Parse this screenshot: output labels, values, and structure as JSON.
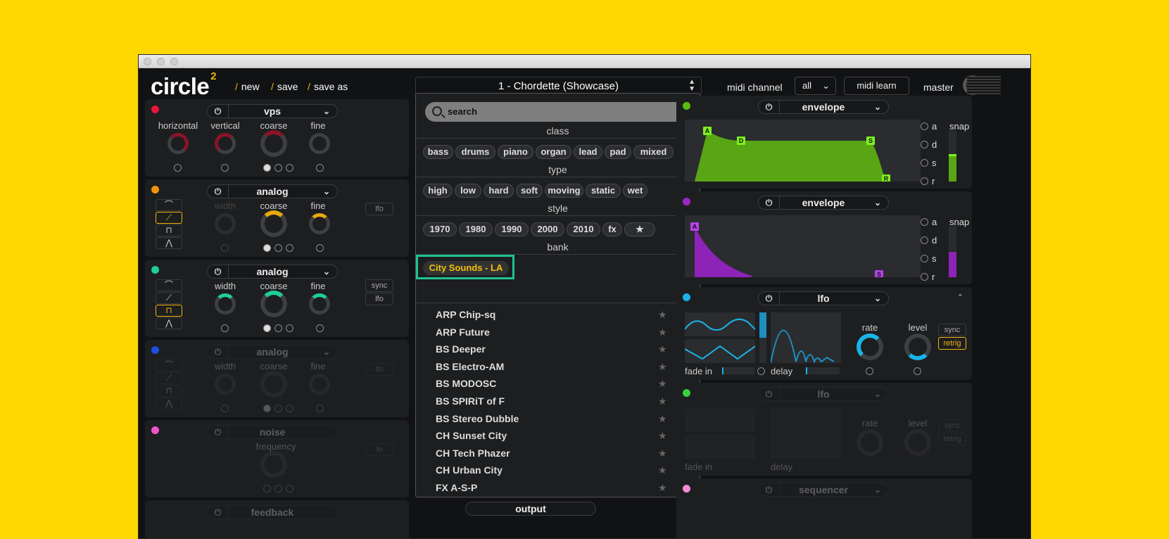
{
  "app": {
    "logo": "circle",
    "logo_sup": "2",
    "new": "new",
    "save": "save",
    "save_as": "save as",
    "preset": "1 - Chordette (Showcase)",
    "midi_channel_label": "midi channel",
    "midi_channel_value": "all",
    "midi_learn": "midi learn",
    "master": "master"
  },
  "modules": {
    "m1": {
      "name": "vps",
      "labels": [
        "horizontal",
        "vertical",
        "coarse",
        "fine"
      ],
      "color": "#e8153d"
    },
    "m2": {
      "name": "analog",
      "labels": [
        "width",
        "coarse",
        "fine"
      ],
      "btn": "lfo",
      "color": "#f2920c"
    },
    "m3": {
      "name": "analog",
      "labels": [
        "width",
        "coarse",
        "fine"
      ],
      "btn1": "sync",
      "btn2": "lfo",
      "color": "#1fcf95"
    },
    "m4": {
      "name": "analog",
      "labels": [
        "width",
        "coarse",
        "fine"
      ],
      "btn": "lfo",
      "color": "#1a4fe0"
    },
    "m5": {
      "name": "noise",
      "labels": [
        "frequency"
      ],
      "btn": "lo",
      "color": "#f055c8"
    },
    "m6": {
      "name": "feedback"
    }
  },
  "browser": {
    "search_placeholder": "search",
    "class_title": "class",
    "class": [
      "bass",
      "drums",
      "piano",
      "organ",
      "lead",
      "pad",
      "mixed"
    ],
    "type_title": "type",
    "type": [
      "high",
      "low",
      "hard",
      "soft",
      "moving",
      "static",
      "wet"
    ],
    "style_title": "style",
    "style": [
      "1970",
      "1980",
      "1990",
      "2000",
      "2010",
      "fx",
      "★"
    ],
    "bank_title": "bank",
    "bank_selected": "City Sounds - LA",
    "presets": [
      "ARP Chip-sq",
      "ARP Future",
      "BS Deeper",
      "BS Electro-AM",
      "BS MODOSC",
      "BS SPIRiT of F",
      "BS Stereo Dubble",
      "CH Sunset City",
      "CH Tech Phazer",
      "CH Urban City",
      "FX A-S-P"
    ],
    "star": "★",
    "output": "output"
  },
  "right": {
    "env1": {
      "name": "envelope",
      "color": "#58bd13",
      "nodes": [
        "A",
        "D",
        "S",
        "R"
      ]
    },
    "env2": {
      "name": "envelope",
      "color": "#9d25c7",
      "nodes": [
        "A",
        "S"
      ]
    },
    "options": [
      "a",
      "d",
      "s",
      "r"
    ],
    "snap": "snap",
    "lfo1": {
      "name": "lfo",
      "color": "#19b4e8",
      "rate": "rate",
      "level": "level",
      "sync": "sync",
      "retrig": "retrig",
      "fade_in": "fade in",
      "delay": "delay"
    },
    "lfo2": {
      "name": "lfo",
      "color": "#3bcf3b",
      "rate": "rate",
      "level": "level",
      "sync": "sync",
      "retrig": "retrig",
      "fade_in": "fade in",
      "delay": "delay"
    },
    "seq": {
      "name": "sequencer",
      "color": "#f58ad6"
    }
  }
}
